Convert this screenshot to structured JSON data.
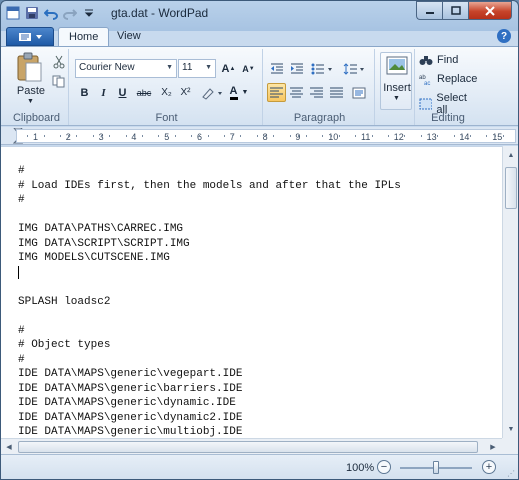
{
  "window": {
    "title": "gta.dat - WordPad",
    "minimize_icon": "minimize-icon",
    "maximize_icon": "maximize-icon",
    "close_icon": "close-icon"
  },
  "quick_access": {
    "icons": [
      "wordpad-app-icon",
      "save-icon",
      "undo-icon",
      "redo-icon",
      "customize-dropdown-icon"
    ]
  },
  "ribbon_tabs": {
    "home": "Home",
    "view": "View"
  },
  "clipboard": {
    "label": "Clipboard",
    "paste_label": "Paste"
  },
  "font": {
    "label": "Font",
    "family": "Courier New",
    "size": "11",
    "bold": "B",
    "italic": "I",
    "underline": "U",
    "strike": "abc",
    "subscript": "X₂",
    "superscript": "X²",
    "color_letter": "A"
  },
  "paragraph": {
    "label": "Paragraph"
  },
  "insert": {
    "label": "Insert"
  },
  "editing": {
    "label": "Editing",
    "find": "Find",
    "replace": "Replace",
    "select_all": "Select all"
  },
  "ruler": {
    "ticks": [
      "1",
      "2",
      "3",
      "4",
      "5",
      "6",
      "7",
      "8",
      "9",
      "10",
      "11",
      "12",
      "13",
      "14",
      "15"
    ]
  },
  "document": {
    "lines": [
      "#",
      "# Load IDEs first, then the models and after that the IPLs",
      "#",
      "",
      "IMG DATA\\PATHS\\CARREC.IMG",
      "IMG DATA\\SCRIPT\\SCRIPT.IMG",
      "IMG MODELS\\CUTSCENE.IMG",
      "",
      "",
      "SPLASH loadsc2",
      "",
      "#",
      "# Object types",
      "#",
      "IDE DATA\\MAPS\\generic\\vegepart.IDE",
      "IDE DATA\\MAPS\\generic\\barriers.IDE",
      "IDE DATA\\MAPS\\generic\\dynamic.IDE",
      "IDE DATA\\MAPS\\generic\\dynamic2.IDE",
      "IDE DATA\\MAPS\\generic\\multiobj.IDE"
    ]
  },
  "status": {
    "zoom": "100%",
    "zoom_level": 100
  },
  "colors": {
    "accent": "#2f6fc2",
    "selected": "#f8c660",
    "close": "#c7442a"
  }
}
